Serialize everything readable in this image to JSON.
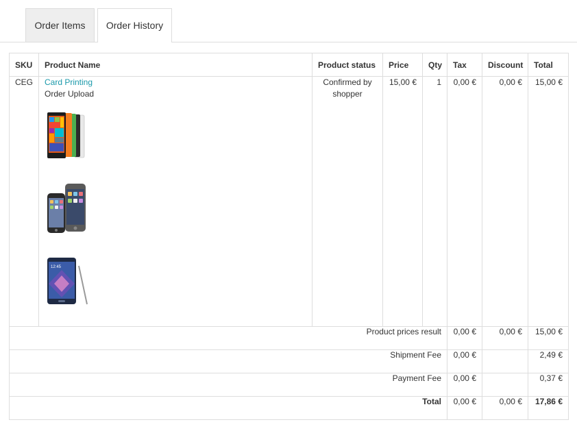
{
  "tabs": [
    {
      "label": "Order Items",
      "active": false
    },
    {
      "label": "Order History",
      "active": true
    }
  ],
  "table": {
    "headers": {
      "sku": "SKU",
      "name": "Product Name",
      "status": "Product status",
      "price": "Price",
      "qty": "Qty",
      "tax": "Tax",
      "discount": "Discount",
      "total": "Total"
    },
    "item": {
      "sku": "CEG",
      "name": "Card Printing",
      "subtitle": "Order Upload",
      "status": "Confirmed by shopper",
      "price": "15,00 €",
      "qty": "1",
      "tax": "0,00 €",
      "discount": "0,00 €",
      "total": "15,00 €",
      "images": [
        "phone-lumia-image",
        "phone-iphone-image",
        "phone-galaxy-note-image"
      ]
    }
  },
  "summary": {
    "product_prices": {
      "label": "Product prices result",
      "tax": "0,00 €",
      "discount": "0,00 €",
      "total": "15,00 €"
    },
    "shipment": {
      "label": "Shipment Fee",
      "tax": "0,00 €",
      "total": "2,49 €"
    },
    "payment": {
      "label": "Payment Fee",
      "tax": "0,00 €",
      "total": "0,37 €"
    },
    "grand": {
      "label": "Total",
      "tax": "0,00 €",
      "discount": "0,00 €",
      "total": "17,86 €"
    }
  },
  "colors": {
    "link": "#1a99aa",
    "border": "#dddddd",
    "tab_inactive_bg": "#eeeeee"
  }
}
